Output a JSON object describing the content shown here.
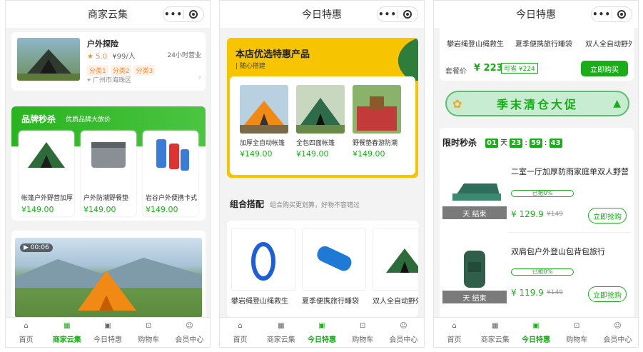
{
  "colors": {
    "accent": "#1aad19",
    "orange": "#f08a3c",
    "yellow": "#f6c400"
  },
  "tabbar": [
    {
      "label": "首页",
      "icon": "home-icon"
    },
    {
      "label": "商家云集",
      "icon": "grid-icon"
    },
    {
      "label": "今日特惠",
      "icon": "gift-icon"
    },
    {
      "label": "购物车",
      "icon": "cart-icon"
    },
    {
      "label": "会员中心",
      "icon": "user-icon"
    }
  ],
  "screen1": {
    "title": "商家云集",
    "merchant": {
      "name": "户外探险",
      "rating": "5.0",
      "per_person": "¥99/人",
      "hours": "24小时营业",
      "tags": [
        "分类1",
        "分类2",
        "分类3"
      ],
      "address": "广州市海珠区"
    },
    "flash": {
      "title": "品牌秒杀",
      "subtitle": "优质品牌大放价",
      "items": [
        {
          "name": "帐篷户外野营加厚",
          "price": "¥149.00"
        },
        {
          "name": "户外防潮野餐垫",
          "price": "¥149.00"
        },
        {
          "name": "岩谷户外便携卡式",
          "price": "¥149.00"
        }
      ]
    },
    "video": {
      "duration": "00:06"
    }
  },
  "screen2": {
    "title": "今日特惠",
    "featured": {
      "title": "本店优选特惠产品",
      "subtitle": "随心搭建",
      "items": [
        {
          "name": "加厚全自动帐篷",
          "price": "¥149.00"
        },
        {
          "name": "全包四面帐篷",
          "price": "¥149.00"
        },
        {
          "name": "野餐垫春游防潮",
          "price": "¥149.00"
        }
      ]
    },
    "combo": {
      "title": "组合搭配",
      "subtitle": "组合购买更划算，好物不容错过",
      "items": [
        {
          "name": "攀岩绳登山绳救生"
        },
        {
          "name": "夏季便携旅行睡袋"
        },
        {
          "name": "双人全自动野外"
        }
      ]
    }
  },
  "screen3": {
    "title": "今日特惠",
    "combo_names": [
      "攀岩绳登山绳救生",
      "夏季便携旅行睡袋",
      "双人全自动野外"
    ],
    "package": {
      "label": "套餐价",
      "price": "¥ 223",
      "save": "可省 ¥224",
      "buy": "立即购买"
    },
    "banner_text": "季末清仓大促",
    "seckill": {
      "title": "限时秒杀",
      "countdown": {
        "days": "01",
        "day_unit": "天",
        "h": "23",
        "m": "59",
        "s": "43"
      },
      "items": [
        {
          "name": "二室一厅加厚防雨家庭单双人野营",
          "sold": "已抢0%",
          "sold_pct": 0,
          "price": "¥ 129.9",
          "old": "¥149",
          "status": "天 结束",
          "buy": "立即抢购"
        },
        {
          "name": "双肩包户外登山包背包旅行",
          "sold": "已抢0%",
          "sold_pct": 0,
          "price": "¥ 119.9",
          "old": "¥149",
          "status": "天 结束",
          "buy": "立即抢购"
        }
      ]
    }
  }
}
